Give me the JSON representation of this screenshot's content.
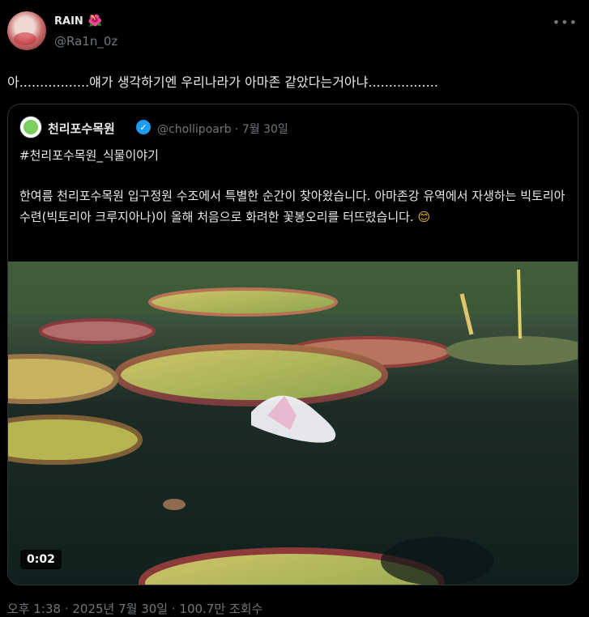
{
  "tweet": {
    "author_name": "RAIN",
    "author_emoji": "🌺",
    "author_handle": "@Ra1n_0z",
    "text": "아.................얘가 생각하기엔 우리나라가 아마존 같았다는거아냐................."
  },
  "quote": {
    "author_name": "천리포수목원",
    "author_handle": "@chollipoarb · 7월 30일",
    "hashtag": "#천리포수목원_식물이야기",
    "body": "한여름 천리포수목원 입구정원 수조에서 특별한 순간이 찾아왔습니다. 아마존강 유역에서 자생하는 빅토리아수련(빅토리아 크루지아나)이 올해 처음으로 화려한 꽃봉오리를 터뜨렸습니다.",
    "emoji": "😊",
    "video_duration": "0:02"
  },
  "footer": {
    "meta": "오후 1:38 · 2025년 7월 30일 · 100.7만 조회수"
  },
  "colors": {
    "background": "#000000",
    "text": "#e7e9ea",
    "muted": "#71767b",
    "border": "#2f3336",
    "verified": "#1d9bf0"
  }
}
